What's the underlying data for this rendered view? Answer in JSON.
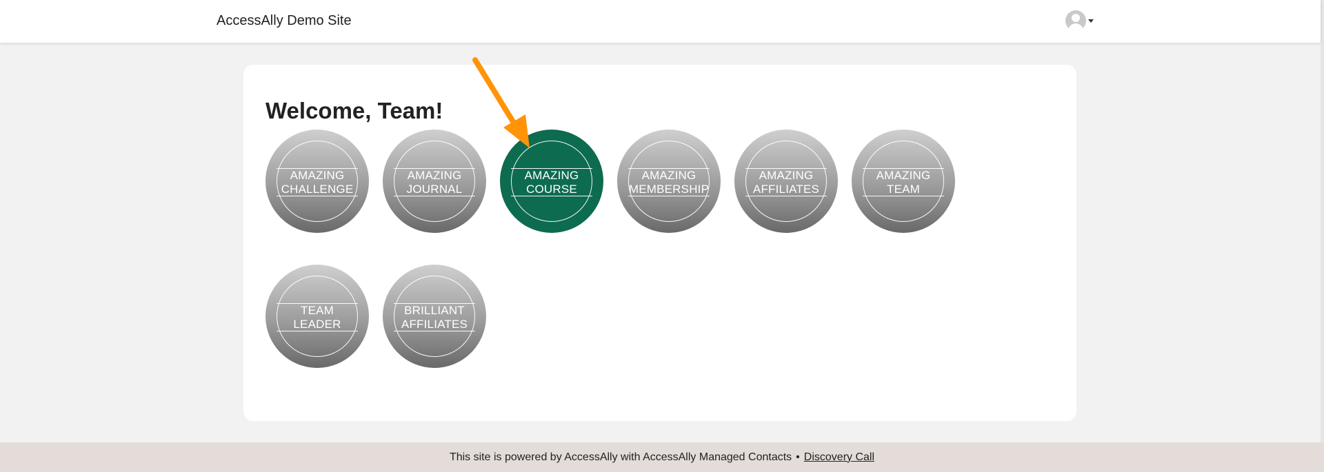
{
  "header": {
    "site_title": "AccessAlly Demo Site",
    "user_menu": {
      "avatar_icon": "user-avatar-icon",
      "dropdown_icon": "caret-down-icon"
    }
  },
  "main": {
    "welcome": "Welcome, Team!",
    "tiles": [
      {
        "line1": "Amazing",
        "line2": "Challenge",
        "active": false
      },
      {
        "line1": "Amazing",
        "line2": "Journal",
        "active": false
      },
      {
        "line1": "Amazing",
        "line2": "Course",
        "active": true
      },
      {
        "line1": "Amazing",
        "line2": "Membership",
        "active": false
      },
      {
        "line1": "Amazing",
        "line2": "Affiliates",
        "active": false
      },
      {
        "line1": "Amazing",
        "line2": "Team",
        "active": false
      },
      {
        "line1": "Team",
        "line2": "Leader",
        "active": false
      },
      {
        "line1": "Brilliant",
        "line2": "Affiliates",
        "active": false
      }
    ]
  },
  "annotation": {
    "icon": "arrow-icon",
    "color": "#ff9408"
  },
  "footer": {
    "text": "This site is powered by AccessAlly with AccessAlly Managed Contacts",
    "separator": "•",
    "link": "Discovery Call"
  },
  "colors": {
    "active_tile": "#0d6b50",
    "tile_gradient_top": "#cfcfcf",
    "tile_gradient_bottom": "#696969",
    "page_background": "#f2f2f2",
    "footer_background": "#e4dcd8"
  }
}
